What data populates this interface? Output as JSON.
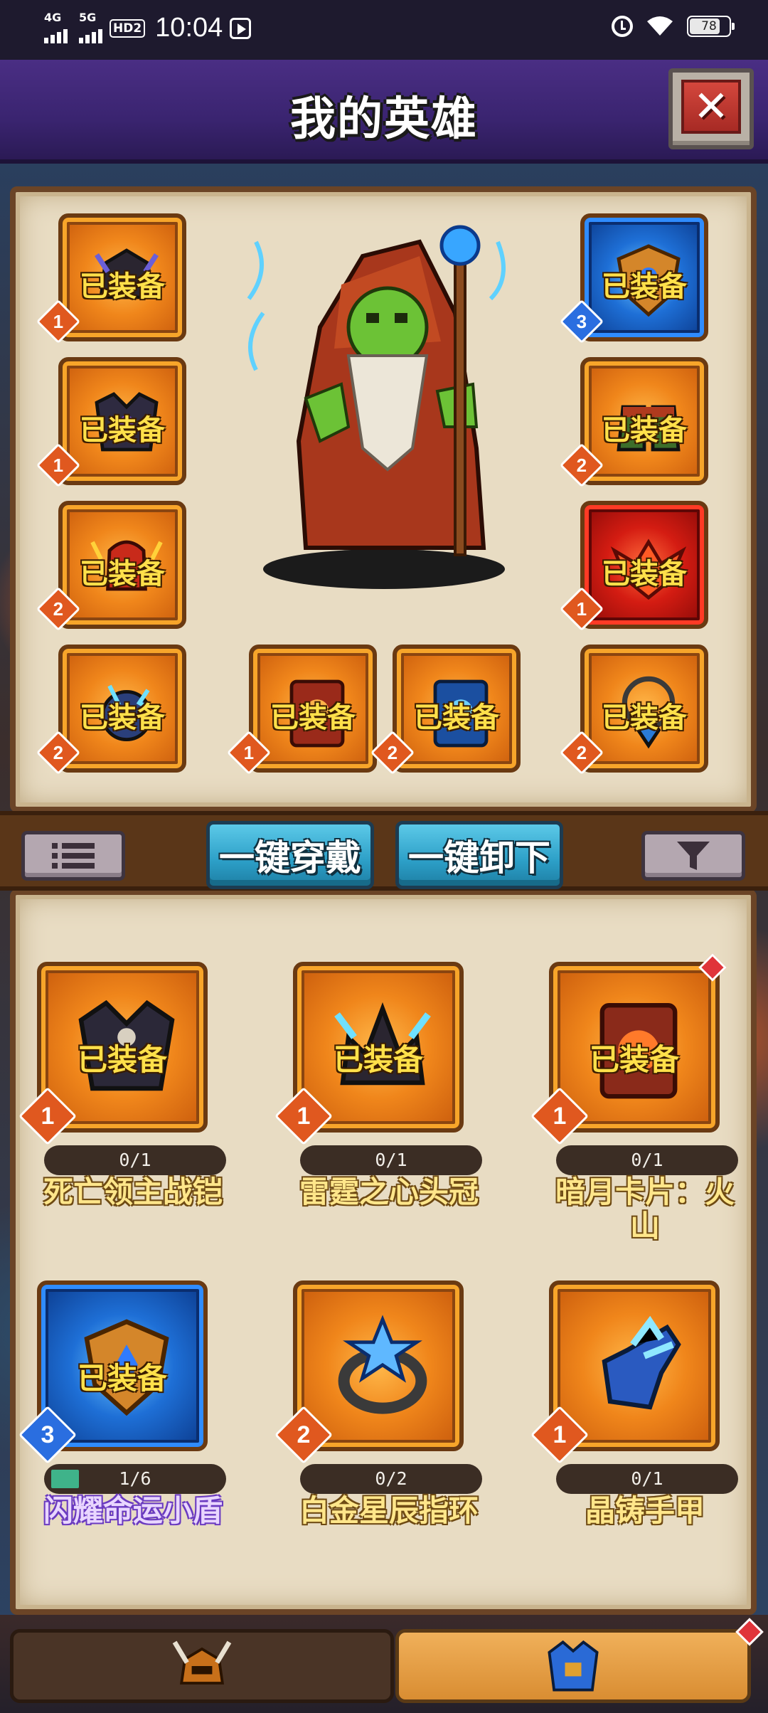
{
  "status_bar": {
    "signal_1": "4G",
    "signal_2": "5G",
    "hd_badge": "HD2",
    "time": "10:04",
    "battery": "78"
  },
  "header": {
    "title": "我的英雄"
  },
  "equipped_label": "已装备",
  "slots": [
    {
      "id": "helmet",
      "level": "1",
      "color": "orange"
    },
    {
      "id": "shoulder",
      "level": "3",
      "color": "blue"
    },
    {
      "id": "chest",
      "level": "1",
      "color": "orange"
    },
    {
      "id": "boots",
      "level": "2",
      "color": "orange"
    },
    {
      "id": "gauntlet",
      "level": "2",
      "color": "orange"
    },
    {
      "id": "phoenix",
      "level": "1",
      "color": "red"
    },
    {
      "id": "storm-orb",
      "level": "2",
      "color": "orange"
    },
    {
      "id": "card-1",
      "level": "1",
      "color": "orange"
    },
    {
      "id": "card-2",
      "level": "2",
      "color": "orange"
    },
    {
      "id": "amulet",
      "level": "2",
      "color": "orange"
    }
  ],
  "actions": {
    "equip_all": "一键穿戴",
    "unequip_all": "一键卸下"
  },
  "items": [
    {
      "name": "死亡领主战铠",
      "count": "0/1",
      "level": "1",
      "equipped": true,
      "progress": 0
    },
    {
      "name": "雷霆之心头冠",
      "count": "0/1",
      "level": "1",
      "equipped": true,
      "progress": 0
    },
    {
      "name": "暗月卡片：火山",
      "count": "0/1",
      "level": "1",
      "equipped": true,
      "progress": 0,
      "new": true
    },
    {
      "name": "闪耀命运小盾",
      "count": "1/6",
      "level": "3",
      "equipped": true,
      "progress": 0.1667
    },
    {
      "name": "白金星辰指环",
      "count": "0/2",
      "level": "2",
      "equipped": false,
      "progress": 0
    },
    {
      "name": "晶铸手甲",
      "count": "0/1",
      "level": "1",
      "equipped": false,
      "progress": 0
    }
  ],
  "colors": {
    "equipped_text": "#ffe04a",
    "level_orange": "#e0581f",
    "level_blue": "#2a6ee0",
    "action_button": "#2c9fc7"
  }
}
